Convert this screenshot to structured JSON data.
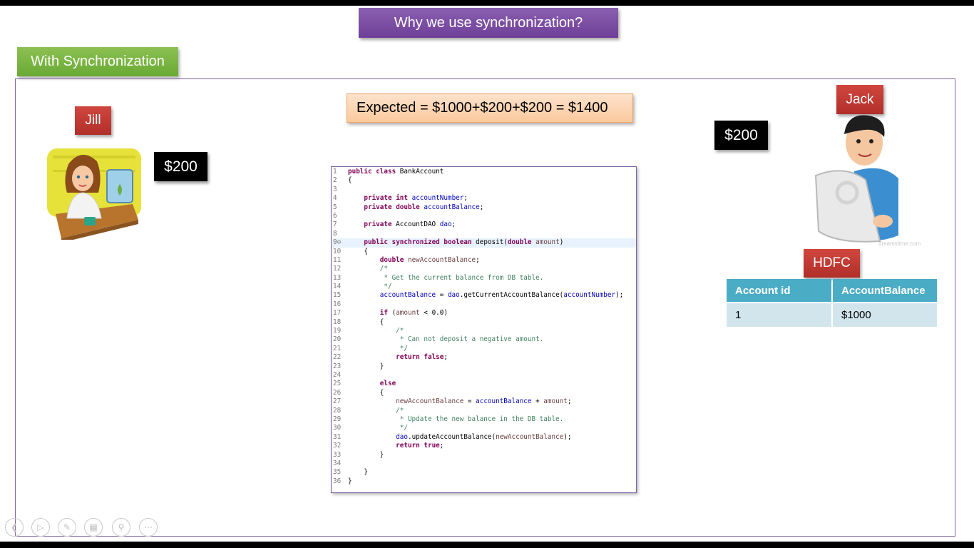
{
  "slide": {
    "title": "Why we use synchronization?",
    "section_label": "With Synchronization",
    "expected": "Expected = $1000+$200+$200 = $1400"
  },
  "jill": {
    "label": "Jill",
    "amount": "$200"
  },
  "jack": {
    "label": "Jack",
    "amount": "$200"
  },
  "bank": {
    "label": "HDFC",
    "columns": [
      "Account id",
      "AccountBalance"
    ],
    "rows": [
      [
        "1",
        "$1000"
      ]
    ]
  },
  "watermark": "dreamstime.com",
  "code_lines": [
    "public class BankAccount",
    "{",
    "",
    "    private int accountNumber;",
    "    private double accountBalance;",
    "",
    "    private AccountDAO dao;",
    "",
    "    public synchronized boolean deposit(double amount)",
    "    {",
    "        double newAccountBalance;",
    "        /*",
    "         * Get the current balance from DB table.",
    "         */",
    "        accountBalance = dao.getCurrentAccountBalance(accountNumber);",
    "",
    "        if (amount < 0.0)",
    "        {",
    "            /*",
    "             * Can not deposit a negative amount.",
    "             */",
    "            return false;",
    "        }",
    "",
    "        else",
    "        {",
    "            newAccountBalance = accountBalance + amount;",
    "            /*",
    "             * Update the new balance in the DB table.",
    "             */",
    "            dao.updateAccountBalance(newAccountBalance);",
    "            return true;",
    "        }",
    "",
    "    }",
    "}"
  ],
  "line_numbers": [
    "1",
    "2",
    "3",
    "4",
    "5",
    "6",
    "7",
    "8",
    "9⊖",
    "10",
    "11",
    "12",
    "13",
    "14",
    "15",
    "16",
    "17",
    "18",
    "19",
    "20",
    "21",
    "22",
    "23",
    "24",
    "25",
    "26",
    "27",
    "28",
    "29",
    "30",
    "31",
    "32",
    "33",
    "34",
    "35",
    "36"
  ],
  "nav_icons": [
    "back-icon",
    "play-icon",
    "pen-icon",
    "slides-icon",
    "zoom-icon",
    "more-icon"
  ],
  "colors": {
    "title_bg": "#7a4ca2",
    "section_bg": "#77b33f",
    "label_red": "#c0392b",
    "frame_border": "#8064a2",
    "table_header": "#4bacc6",
    "table_cell": "#d2e5ec"
  }
}
